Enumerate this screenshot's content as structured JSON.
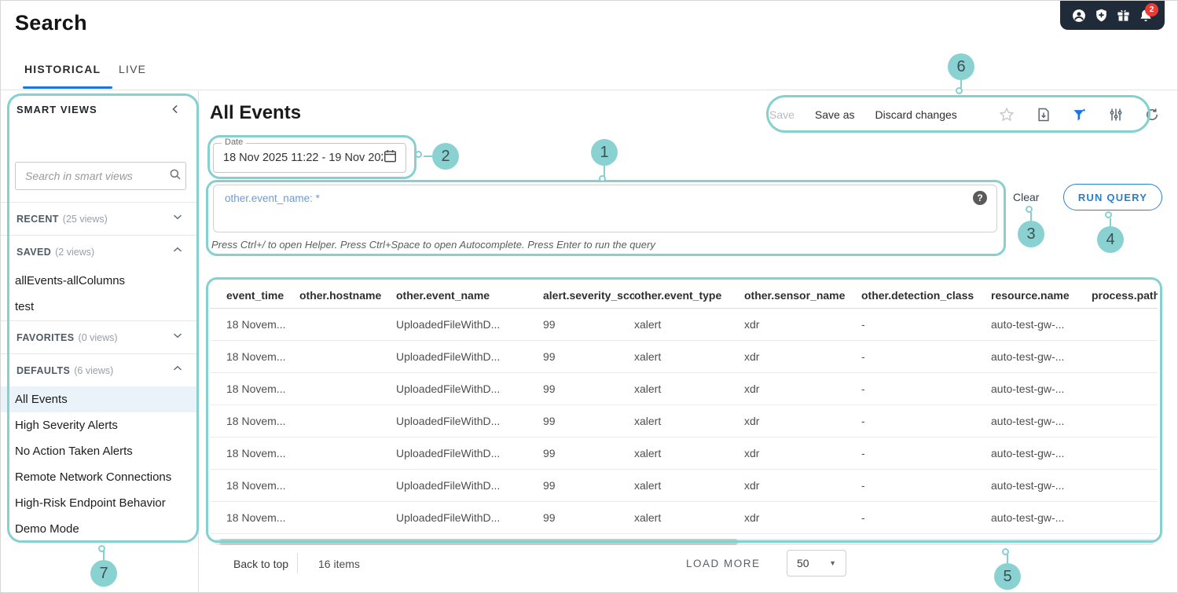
{
  "page": {
    "title": "Search"
  },
  "header": {
    "icons": [
      "user-icon",
      "shield-plus-icon",
      "gift-icon",
      "bell-icon"
    ],
    "notification_count": "2"
  },
  "tabs": [
    {
      "label": "HISTORICAL",
      "active": true
    },
    {
      "label": "LIVE",
      "active": false
    }
  ],
  "sidebar": {
    "title": "SMART VIEWS",
    "search_placeholder": "Search in smart views",
    "sections": [
      {
        "name": "RECENT",
        "count": "(25 views)",
        "state": "collapsed",
        "items": []
      },
      {
        "name": "SAVED",
        "count": "(2 views)",
        "state": "expanded",
        "items": [
          "allEvents-allColumns",
          "test"
        ]
      },
      {
        "name": "FAVORITES",
        "count": "(0 views)",
        "state": "collapsed",
        "items": []
      },
      {
        "name": "DEFAULTS",
        "count": "(6 views)",
        "state": "expanded",
        "items": [
          "All Events",
          "High Severity Alerts",
          "No Action Taken Alerts",
          "Remote Network Connections",
          "High-Risk Endpoint Behavior",
          "Demo Mode"
        ],
        "selected": "All Events"
      }
    ]
  },
  "main": {
    "view_title": "All Events",
    "toolbar": {
      "save": "Save",
      "save_as": "Save as",
      "discard": "Discard changes"
    },
    "date_field": {
      "label": "Date",
      "value": "18 Nov 2025 11:22 - 19 Nov 202..."
    },
    "query": {
      "text": "other.event_name: *",
      "hint": "Press Ctrl+/ to open Helper. Press Ctrl+Space to open Autocomplete. Press Enter to run the query",
      "clear_label": "Clear",
      "run_label": "RUN QUERY"
    }
  },
  "table": {
    "columns": [
      "event_time",
      "other.hostname",
      "other.event_name",
      "alert.severity_score",
      "other.event_type",
      "other.sensor_name",
      "other.detection_class",
      "resource.name",
      "process.path"
    ],
    "rows": [
      [
        "18 Novem...",
        "",
        "UploadedFileWithD...",
        "99",
        "xalert",
        "xdr",
        "-",
        "auto-test-gw-...",
        ""
      ],
      [
        "18 Novem...",
        "",
        "UploadedFileWithD...",
        "99",
        "xalert",
        "xdr",
        "-",
        "auto-test-gw-...",
        ""
      ],
      [
        "18 Novem...",
        "",
        "UploadedFileWithD...",
        "99",
        "xalert",
        "xdr",
        "-",
        "auto-test-gw-...",
        ""
      ],
      [
        "18 Novem...",
        "",
        "UploadedFileWithD...",
        "99",
        "xalert",
        "xdr",
        "-",
        "auto-test-gw-...",
        ""
      ],
      [
        "18 Novem...",
        "",
        "UploadedFileWithD...",
        "99",
        "xalert",
        "xdr",
        "-",
        "auto-test-gw-...",
        ""
      ],
      [
        "18 Novem...",
        "",
        "UploadedFileWithD...",
        "99",
        "xalert",
        "xdr",
        "-",
        "auto-test-gw-...",
        ""
      ],
      [
        "18 Novem...",
        "",
        "UploadedFileWithD...",
        "99",
        "xalert",
        "xdr",
        "-",
        "auto-test-gw-...",
        ""
      ]
    ]
  },
  "footer": {
    "back_to_top": "Back to top",
    "items_count": "16 items",
    "load_more": "LOAD MORE",
    "page_size": "50"
  },
  "annotations": {
    "color": "#86d0d0",
    "callouts": [
      "1",
      "2",
      "3",
      "4",
      "5",
      "6",
      "7"
    ]
  }
}
